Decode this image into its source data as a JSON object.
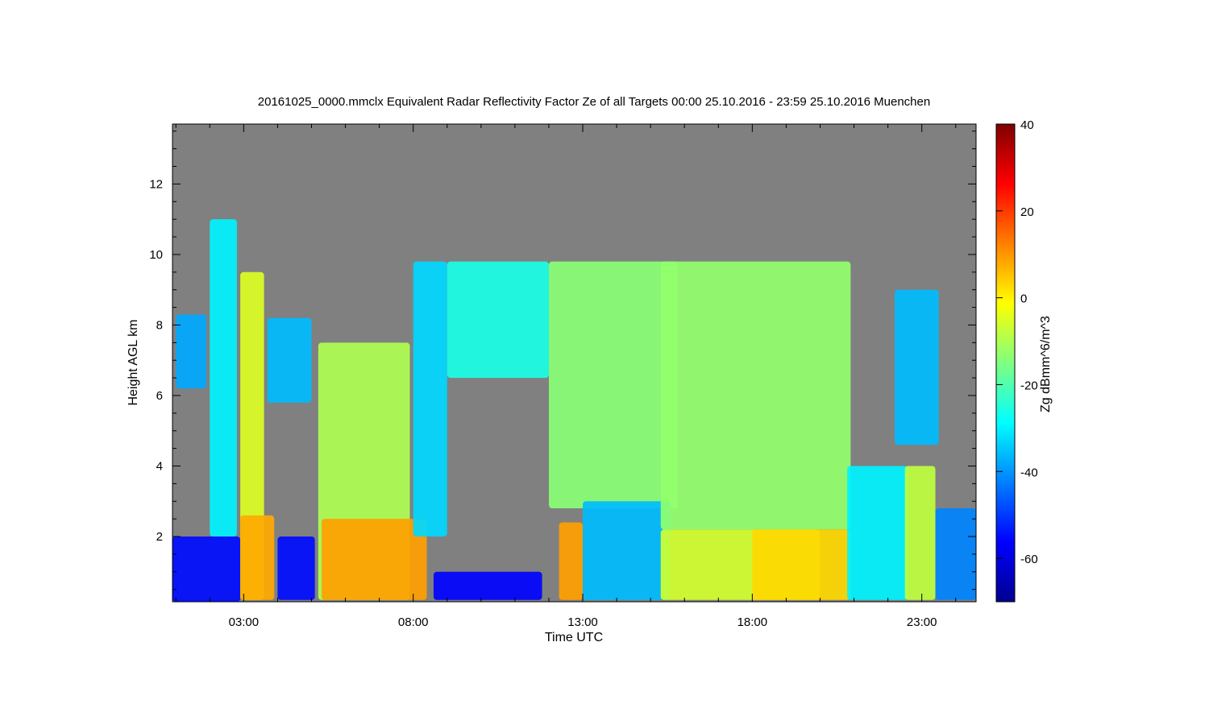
{
  "chart_data": {
    "type": "heatmap",
    "title": "20161025_0000.mmclx Equivalent Radar Reflectivity Factor Ze of all Targets   00:00 25.10.2016 - 23:59 25.10.2016 Muenchen",
    "xlabel": "Time UTC",
    "ylabel": "Height AGL km",
    "colorbar_label": "Zg dBmm^6/m^3",
    "xlim": [
      0.9,
      24.6
    ],
    "ylim": [
      0.15,
      13.7
    ],
    "x_ticks": [
      3,
      8,
      13,
      18,
      23
    ],
    "x_tick_labels": [
      "03:00",
      "08:00",
      "13:00",
      "18:00",
      "23:00"
    ],
    "y_ticks": [
      2,
      4,
      6,
      8,
      10,
      12
    ],
    "y_tick_labels": [
      "2",
      "4",
      "6",
      "8",
      "10",
      "12"
    ],
    "colorbar_range": [
      -70,
      40
    ],
    "colorbar_ticks": [
      40,
      20,
      0,
      -20,
      -40,
      -60
    ],
    "colorbar_tick_labels": [
      "40",
      "20",
      "0",
      "-20",
      "-40",
      "-60"
    ],
    "colormap": "jet",
    "no_data_color": "#808080",
    "grid": false,
    "cloud_blocks": [
      {
        "t0": 0.9,
        "t1": 2.9,
        "top_km": 2.0,
        "ze_dbz": -55
      },
      {
        "t0": 1.0,
        "t1": 1.9,
        "top_km": 8.3,
        "bottom_km": 6.2,
        "ze_dbz": -38
      },
      {
        "t0": 2.0,
        "t1": 2.8,
        "top_km": 11.0,
        "bottom_km": 2.0,
        "ze_dbz": -30
      },
      {
        "t0": 2.9,
        "t1": 3.6,
        "top_km": 9.5,
        "bottom_km": 0.2,
        "ze_dbz": -5
      },
      {
        "t0": 2.9,
        "t1": 3.9,
        "top_km": 2.6,
        "bottom_km": 0.2,
        "ze_dbz": 8
      },
      {
        "t0": 3.7,
        "t1": 5.0,
        "top_km": 8.2,
        "bottom_km": 5.8,
        "ze_dbz": -36
      },
      {
        "t0": 4.0,
        "t1": 5.1,
        "top_km": 2.0,
        "bottom_km": 0.2,
        "ze_dbz": -55
      },
      {
        "t0": 5.2,
        "t1": 7.9,
        "top_km": 7.5,
        "bottom_km": 0.2,
        "ze_dbz": -10
      },
      {
        "t0": 5.3,
        "t1": 8.4,
        "top_km": 2.5,
        "bottom_km": 0.2,
        "ze_dbz": 9
      },
      {
        "t0": 8.0,
        "t1": 9.0,
        "top_km": 9.8,
        "bottom_km": 2.0,
        "ze_dbz": -33
      },
      {
        "t0": 8.6,
        "t1": 11.8,
        "top_km": 1.0,
        "bottom_km": 0.2,
        "ze_dbz": -56
      },
      {
        "t0": 9.0,
        "t1": 12.0,
        "top_km": 9.8,
        "bottom_km": 6.5,
        "ze_dbz": -26
      },
      {
        "t0": 12.0,
        "t1": 15.8,
        "top_km": 9.8,
        "bottom_km": 2.8,
        "ze_dbz": -14
      },
      {
        "t0": 12.3,
        "t1": 13.0,
        "top_km": 2.4,
        "bottom_km": 0.2,
        "ze_dbz": 9
      },
      {
        "t0": 13.0,
        "t1": 15.6,
        "top_km": 3.0,
        "bottom_km": 0.2,
        "ze_dbz": -36
      },
      {
        "t0": 15.3,
        "t1": 20.9,
        "top_km": 9.8,
        "bottom_km": 2.2,
        "ze_dbz": -13
      },
      {
        "t0": 15.3,
        "t1": 20.0,
        "top_km": 2.2,
        "bottom_km": 0.2,
        "ze_dbz": -6
      },
      {
        "t0": 18.0,
        "t1": 20.9,
        "top_km": 2.2,
        "bottom_km": 0.2,
        "ze_dbz": 3
      },
      {
        "t0": 20.8,
        "t1": 22.6,
        "top_km": 4.0,
        "bottom_km": 0.2,
        "ze_dbz": -30
      },
      {
        "t0": 22.2,
        "t1": 23.5,
        "top_km": 9.0,
        "bottom_km": 4.6,
        "ze_dbz": -36
      },
      {
        "t0": 22.5,
        "t1": 23.4,
        "top_km": 4.0,
        "bottom_km": 0.2,
        "ze_dbz": -8
      },
      {
        "t0": 23.4,
        "t1": 24.6,
        "top_km": 2.8,
        "bottom_km": 0.2,
        "ze_dbz": -42
      }
    ]
  }
}
